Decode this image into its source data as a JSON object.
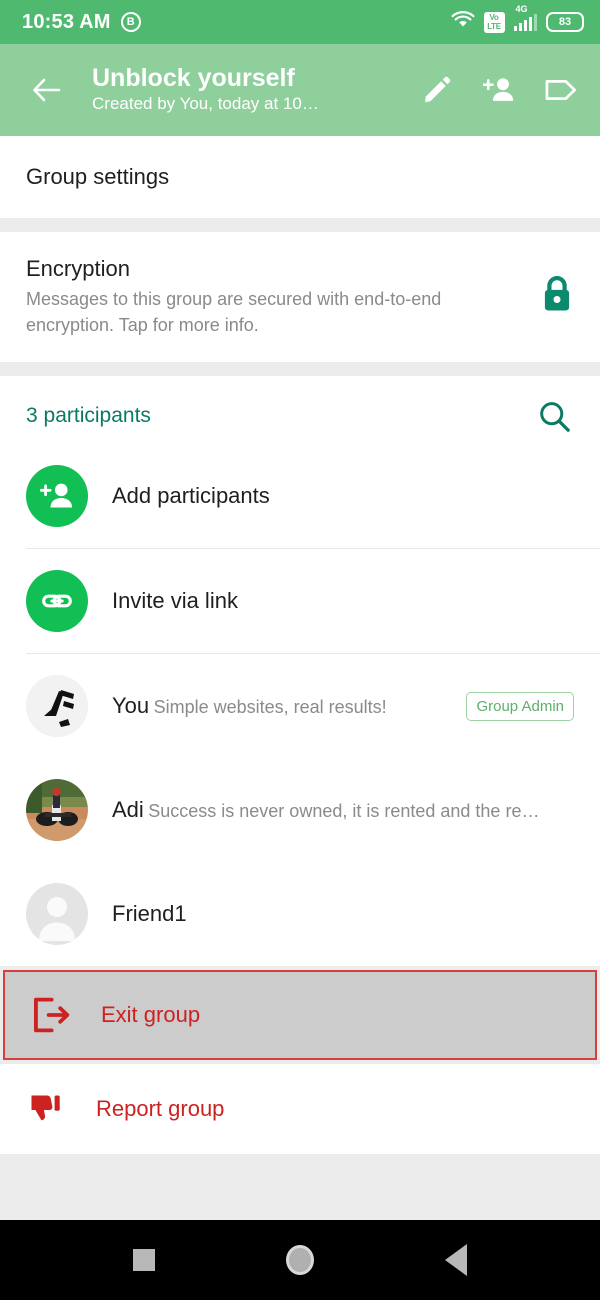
{
  "status_bar": {
    "time": "10:53 AM",
    "app_badge": "B",
    "wifi_icon": "wifi-icon",
    "volte_line1": "Vo",
    "volte_line2": "LTE",
    "network_type": "4G",
    "battery_level": "83"
  },
  "app_bar": {
    "back_icon": "back-arrow-icon",
    "title": "Unblock yourself",
    "subtitle": "Created by You, today at 10…",
    "actions": [
      {
        "name": "edit-icon",
        "label": "Edit"
      },
      {
        "name": "add-member-icon",
        "label": "Add member"
      },
      {
        "name": "tag-icon",
        "label": "Label"
      }
    ]
  },
  "group_settings": {
    "label": "Group settings"
  },
  "encryption": {
    "title": "Encryption",
    "description": "Messages to this group are secured with end-to-end encryption. Tap for more info.",
    "icon": "lock-icon",
    "icon_color": "#0b8a6e"
  },
  "participants": {
    "count_label": "3 participants",
    "search_icon": "search-icon",
    "header_color": "#0b7a63",
    "actions": [
      {
        "label": "Add participants",
        "icon": "add-person-icon"
      },
      {
        "label": "Invite via link",
        "icon": "link-icon"
      }
    ],
    "members": [
      {
        "name": "You",
        "status": "Simple websites, real results!",
        "badge": "Group Admin",
        "avatar": "logo-avatar"
      },
      {
        "name": "Adi",
        "status": "Success is never owned, it is rented and the re…",
        "badge": "",
        "avatar": "photo-avatar"
      },
      {
        "name": "Friend1",
        "status": "",
        "badge": "",
        "avatar": "default-person-avatar"
      }
    ]
  },
  "danger_actions": [
    {
      "label": "Exit group",
      "icon": "exit-icon",
      "highlighted": true
    },
    {
      "label": "Report group",
      "icon": "thumbs-down-icon",
      "highlighted": false
    }
  ],
  "nav_bar": {
    "recents_icon": "recents-square-icon",
    "home_icon": "home-circle-icon",
    "back_icon": "back-triangle-icon"
  },
  "colors": {
    "status_bar_green": "#4fba6f",
    "app_bar_green": "#8fcf9c",
    "accent_green": "#12bf54",
    "danger_red": "#cc2222",
    "highlight_border": "#d3413f",
    "highlight_fill": "#cccccc"
  }
}
